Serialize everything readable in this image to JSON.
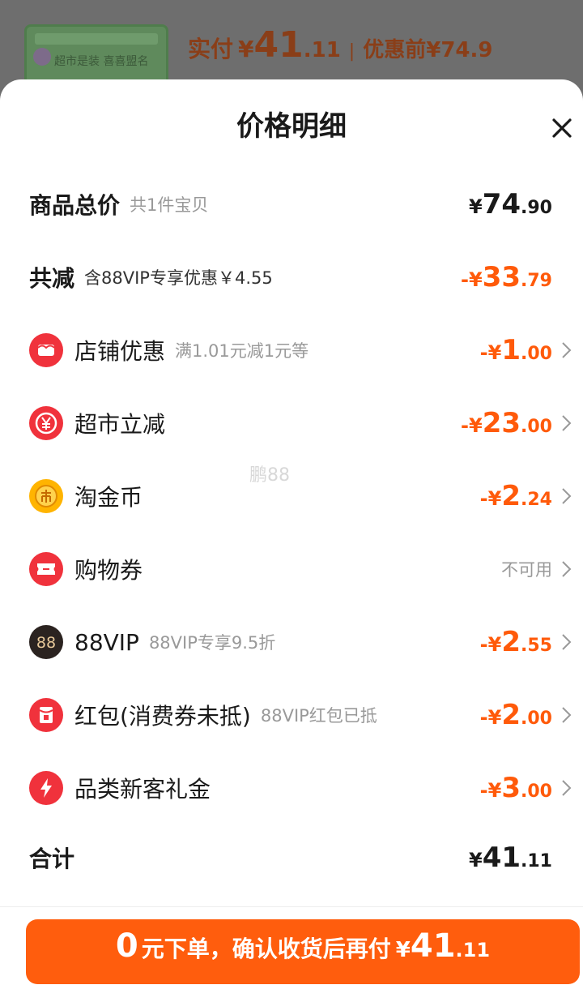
{
  "background": {
    "thumb_text": "超市是装 喜喜盟名",
    "paid_label": "实付",
    "paid_symbol": "¥",
    "paid_int": "41",
    "paid_dec": ".11",
    "separator": "|",
    "orig_label": "优惠前",
    "orig_value": "¥74.9"
  },
  "sheet": {
    "title": "价格明细",
    "close_icon": "close-icon"
  },
  "rows": {
    "total": {
      "label": "商品总价",
      "sub": "共1件宝贝",
      "sym": "¥",
      "int": "74",
      "dec": ".90"
    },
    "reduce": {
      "label": "共减",
      "sub": "含88VIP专享优惠￥4.55",
      "sym": "-¥",
      "int": "33",
      "dec": ".79"
    },
    "shop": {
      "icon": "shop-coupon-icon",
      "label": "店铺优惠",
      "sub": "满1.01元减1元等",
      "sym": "-¥",
      "int": "1",
      "dec": ".00"
    },
    "market": {
      "icon": "yen-discount-icon",
      "label": "超市立减",
      "sym": "-¥",
      "int": "23",
      "dec": ".00"
    },
    "coin": {
      "icon": "gold-coin-icon",
      "label": "淘金币",
      "sym": "-¥",
      "int": "2",
      "dec": ".24"
    },
    "voucher": {
      "icon": "ticket-icon",
      "label": "购物券",
      "status": "不可用"
    },
    "vip": {
      "icon": "vip88-icon",
      "label": "88VIP",
      "sub": "88VIP专享9.5折",
      "sym": "-¥",
      "int": "2",
      "dec": ".55"
    },
    "redpack": {
      "icon": "red-packet-icon",
      "label": "红包(消费券未抵)",
      "sub": "88VIP红包已抵",
      "sym": "-¥",
      "int": "2",
      "dec": ".00"
    },
    "newcust": {
      "icon": "lightning-icon",
      "label": "品类新客礼金",
      "sym": "-¥",
      "int": "3",
      "dec": ".00"
    },
    "sum": {
      "label": "合计",
      "sym": "¥",
      "int": "41",
      "dec": ".11"
    }
  },
  "cta": {
    "zero": "0",
    "text": "元下单，确认收货后再付",
    "sym": "¥",
    "int": "41",
    "dec": ".11"
  },
  "watermark": "鹏88",
  "colors": {
    "accent": "#ff5a0a",
    "button": "#ff5d0d"
  }
}
